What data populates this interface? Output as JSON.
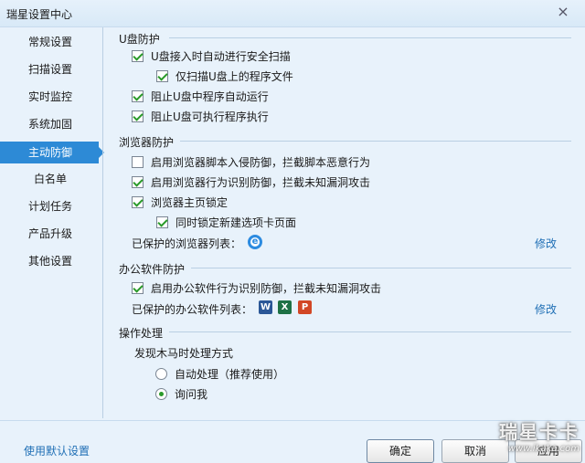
{
  "window": {
    "title": "瑞星设置中心",
    "close_glyph": "×"
  },
  "sidebar": {
    "items": [
      {
        "label": "常规设置"
      },
      {
        "label": "扫描设置"
      },
      {
        "label": "实时监控"
      },
      {
        "label": "系统加固"
      },
      {
        "label": "主动防御"
      },
      {
        "label": "白名单"
      },
      {
        "label": "计划任务"
      },
      {
        "label": "产品升级"
      },
      {
        "label": "其他设置"
      }
    ]
  },
  "usb": {
    "title": "U盘防护",
    "auto_scan": "U盘接入时自动进行安全扫描",
    "scan_programs_only": "仅扫描U盘上的程序文件",
    "block_autorun": "阻止U盘中程序自动运行",
    "block_executables": "阻止U盘可执行程序执行"
  },
  "browser": {
    "title": "浏览器防护",
    "script_defense": "启用浏览器脚本入侵防御，拦截脚本恶意行为",
    "behavior_defense": "启用浏览器行为识别防御，拦截未知漏洞攻击",
    "homepage_lock": "浏览器主页锁定",
    "lock_new_tab": "同时锁定新建选项卡页面",
    "protected_list_label": "已保护的浏览器列表：",
    "modify": "修改"
  },
  "office": {
    "title": "办公软件防护",
    "behavior_defense": "启用办公软件行为识别防御，拦截未知漏洞攻击",
    "protected_list_label": "已保护的办公软件列表：",
    "modify": "修改",
    "apps": [
      {
        "name": "word-icon",
        "letter": "W",
        "color": "#2b5797"
      },
      {
        "name": "excel-icon",
        "letter": "X",
        "color": "#1e7145"
      },
      {
        "name": "powerpoint-icon",
        "letter": "P",
        "color": "#d24726"
      }
    ]
  },
  "action": {
    "title": "操作处理",
    "prompt": "发现木马时处理方式",
    "auto": "自动处理（推荐使用）",
    "ask": "询问我"
  },
  "footer": {
    "default_settings": "使用默认设置",
    "ok": "确定",
    "cancel": "取消",
    "apply": "应用"
  },
  "watermark": {
    "big": "瑞星卡卡",
    "small": "www.ikaka.com"
  }
}
